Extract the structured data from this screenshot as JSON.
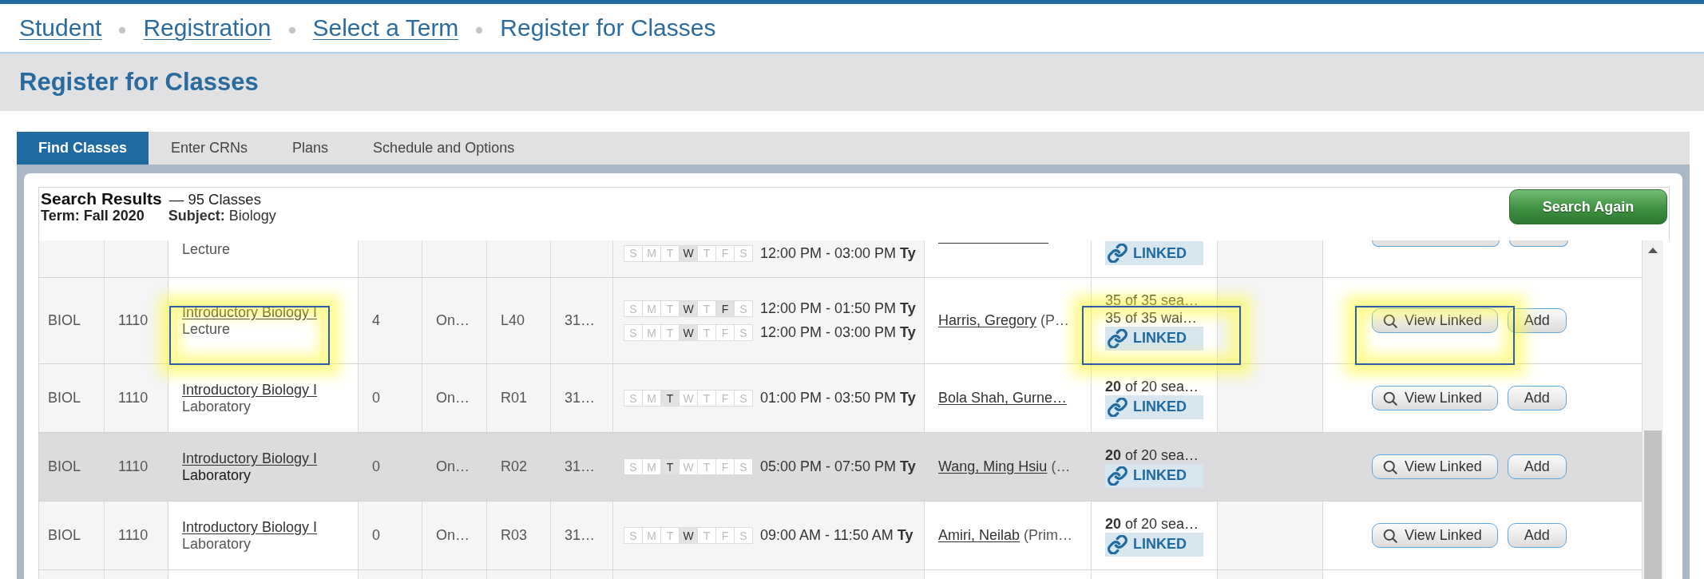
{
  "breadcrumb": [
    {
      "label": "Student",
      "link": true
    },
    {
      "label": "Registration",
      "link": true
    },
    {
      "label": "Select a Term",
      "link": true
    },
    {
      "label": "Register for Classes",
      "link": false
    }
  ],
  "page_title": "Register for Classes",
  "tabs": [
    {
      "label": "Find Classes",
      "selected": true
    },
    {
      "label": "Enter CRNs",
      "selected": false
    },
    {
      "label": "Plans",
      "selected": false
    },
    {
      "label": "Schedule and Options",
      "selected": false
    }
  ],
  "results": {
    "title": "Search Results",
    "count": "— 95 Classes",
    "term": "Term: Fall 2020",
    "subject": "**Subject:** Biology",
    "button": "Search Again"
  },
  "rows": [
    {
      "cut_off": true,
      "hovered": false,
      "callout": false,
      "column_3": {
        "text": "Lecture"
      },
      "column_8": [
        {
          "days": [
            {
              "letter": "S",
              "active": false
            },
            {
              "letter": "M",
              "active": false
            },
            {
              "letter": "T",
              "active": false
            },
            {
              "letter": "W",
              "active": true
            },
            {
              "letter": "T",
              "active": false
            },
            {
              "letter": "F",
              "active": false
            },
            {
              "letter": "S",
              "active": false
            }
          ],
          "time": "12:00 PM - 03:00 PM **Ty**"
        }
      ],
      "column_9": {
        "link_cut": true
      },
      "column_10": {
        "badge": "LINKED"
      },
      "column_12": [
        {
          "kind": "view"
        },
        {
          "kind": "add"
        }
      ]
    },
    {
      "cut_off": false,
      "hovered": false,
      "callout": true,
      "column_1": "BIOL",
      "column_2": "1110",
      "column_3": {
        "link": "Introductory Biology I",
        "text": "Lecture"
      },
      "column_4": "4",
      "column_5": "On…",
      "column_6": "L40",
      "column_7": "31…",
      "column_8": [
        {
          "days": [
            {
              "letter": "S",
              "active": false
            },
            {
              "letter": "M",
              "active": false
            },
            {
              "letter": "T",
              "active": false
            },
            {
              "letter": "W",
              "active": true
            },
            {
              "letter": "T",
              "active": false
            },
            {
              "letter": "F",
              "active": true
            },
            {
              "letter": "S",
              "active": false
            }
          ],
          "time": "12:00 PM - 01:50 PM **Ty**"
        },
        {
          "days": [
            {
              "letter": "S",
              "active": false
            },
            {
              "letter": "M",
              "active": false
            },
            {
              "letter": "T",
              "active": false
            },
            {
              "letter": "W",
              "active": true
            },
            {
              "letter": "T",
              "active": false
            },
            {
              "letter": "F",
              "active": false
            },
            {
              "letter": "S",
              "active": false
            }
          ],
          "time": "12:00 PM - 03:00 PM **Ty**"
        }
      ],
      "column_9": {
        "link": "Harris, Gregory",
        "text": "(P…"
      },
      "column_10": {
        "lines": [
          "35 of 35 sea…",
          "35 of 35 wai…"
        ],
        "badge": "LINKED"
      },
      "column_12": [
        {
          "kind": "view",
          "label": "View Linked"
        },
        {
          "kind": "add",
          "label": "Add"
        }
      ]
    },
    {
      "cut_off": false,
      "hovered": false,
      "callout": false,
      "column_1": "BIOL",
      "column_2": "1110",
      "column_3": {
        "link": "Introductory Biology I",
        "text": "Laboratory"
      },
      "column_4": "0",
      "column_5": "On…",
      "column_6": "R01",
      "column_7": "31…",
      "column_8": [
        {
          "days": [
            {
              "letter": "S",
              "active": false
            },
            {
              "letter": "M",
              "active": false
            },
            {
              "letter": "T",
              "active": true
            },
            {
              "letter": "W",
              "active": false
            },
            {
              "letter": "T",
              "active": false
            },
            {
              "letter": "F",
              "active": false
            },
            {
              "letter": "S",
              "active": false
            }
          ],
          "time": "01:00 PM - 03:50 PM **Ty**"
        }
      ],
      "column_9": {
        "link": "Bola Shah, Gurne…"
      },
      "column_10": {
        "lines": [
          "**20** of 20 sea…"
        ],
        "badge": "LINKED"
      },
      "column_12": [
        {
          "kind": "view",
          "label": "View Linked"
        },
        {
          "kind": "add",
          "label": "Add"
        }
      ]
    },
    {
      "cut_off": false,
      "hovered": true,
      "callout": false,
      "column_1": "BIOL",
      "column_2": "1110",
      "column_3": {
        "link": "Introductory Biology I",
        "text": "Laboratory"
      },
      "column_4": "0",
      "column_5": "On…",
      "column_6": "R02",
      "column_7": "31…",
      "column_8": [
        {
          "days": [
            {
              "letter": "S",
              "active": false
            },
            {
              "letter": "M",
              "active": false
            },
            {
              "letter": "T",
              "active": true
            },
            {
              "letter": "W",
              "active": false
            },
            {
              "letter": "T",
              "active": false
            },
            {
              "letter": "F",
              "active": false
            },
            {
              "letter": "S",
              "active": false
            }
          ],
          "time": "05:00 PM - 07:50 PM **Ty**"
        }
      ],
      "column_9": {
        "link": "Wang, Ming Hsiu",
        "text": "(…"
      },
      "column_10": {
        "lines": [
          "**20** of 20 sea…"
        ],
        "badge": "LINKED"
      },
      "column_12": [
        {
          "kind": "view",
          "label": "View Linked"
        },
        {
          "kind": "add",
          "label": "Add"
        }
      ]
    },
    {
      "cut_off": false,
      "hovered": false,
      "callout": false,
      "column_1": "BIOL",
      "column_2": "1110",
      "column_3": {
        "link": "Introductory Biology I",
        "text": "Laboratory"
      },
      "column_4": "0",
      "column_5": "On…",
      "column_6": "R03",
      "column_7": "31…",
      "column_8": [
        {
          "days": [
            {
              "letter": "S",
              "active": false
            },
            {
              "letter": "M",
              "active": false
            },
            {
              "letter": "T",
              "active": false
            },
            {
              "letter": "W",
              "active": true
            },
            {
              "letter": "T",
              "active": false
            },
            {
              "letter": "F",
              "active": false
            },
            {
              "letter": "S",
              "active": false
            }
          ],
          "time": "09:00 AM - 11:50 AM **Ty**"
        }
      ],
      "column_9": {
        "link": "Amiri, Neilab",
        "text": "(Prim…"
      },
      "column_10": {
        "lines": [
          "**20** of 20 sea…"
        ],
        "badge": "LINKED"
      },
      "column_12": [
        {
          "kind": "view",
          "label": "View Linked"
        },
        {
          "kind": "add",
          "label": "Add"
        }
      ]
    }
  ]
}
